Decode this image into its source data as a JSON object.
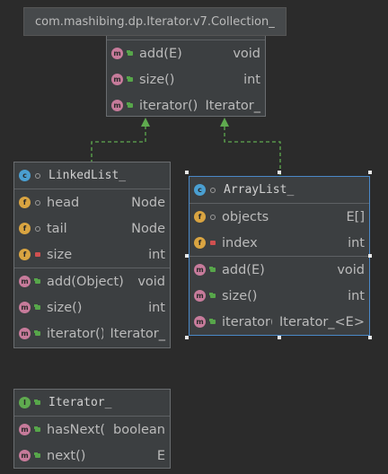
{
  "tooltip": {
    "text": "com.mashibing.dp.Iterator.v7.Collection_"
  },
  "collection": {
    "methods": [
      {
        "name": "add(E)",
        "type": "void"
      },
      {
        "name": "size()",
        "type": "int"
      },
      {
        "name": "iterator()",
        "type": "Iterator_"
      }
    ]
  },
  "linkedlist": {
    "title": "LinkedList_",
    "fields": [
      {
        "name": "head",
        "type": "Node",
        "visibility": "package"
      },
      {
        "name": "tail",
        "type": "Node",
        "visibility": "package"
      },
      {
        "name": "size",
        "type": "int",
        "visibility": "private"
      }
    ],
    "methods": [
      {
        "name": "add(Object)",
        "type": "void"
      },
      {
        "name": "size()",
        "type": "int"
      },
      {
        "name": "iterator()",
        "type": "Iterator_"
      }
    ]
  },
  "arraylist": {
    "title": "ArrayList_",
    "fields": [
      {
        "name": "objects",
        "type": "E[]",
        "visibility": "package"
      },
      {
        "name": "index",
        "type": "int",
        "visibility": "private"
      }
    ],
    "methods": [
      {
        "name": "add(E)",
        "type": "void"
      },
      {
        "name": "size()",
        "type": "int"
      },
      {
        "name": "iterator()",
        "type": "Iterator_<E>"
      }
    ]
  },
  "iterator": {
    "title": "Iterator_",
    "methods": [
      {
        "name": "hasNext()",
        "type": "boolean"
      },
      {
        "name": "next()",
        "type": "E"
      }
    ]
  },
  "icons": {
    "method": "m",
    "field": "f",
    "class": "c",
    "interface": "I"
  },
  "colors": {
    "background": "#2b2b2b",
    "node": "#3c3f41",
    "selection": "#4a88c7",
    "arrow": "#5faa4f"
  }
}
